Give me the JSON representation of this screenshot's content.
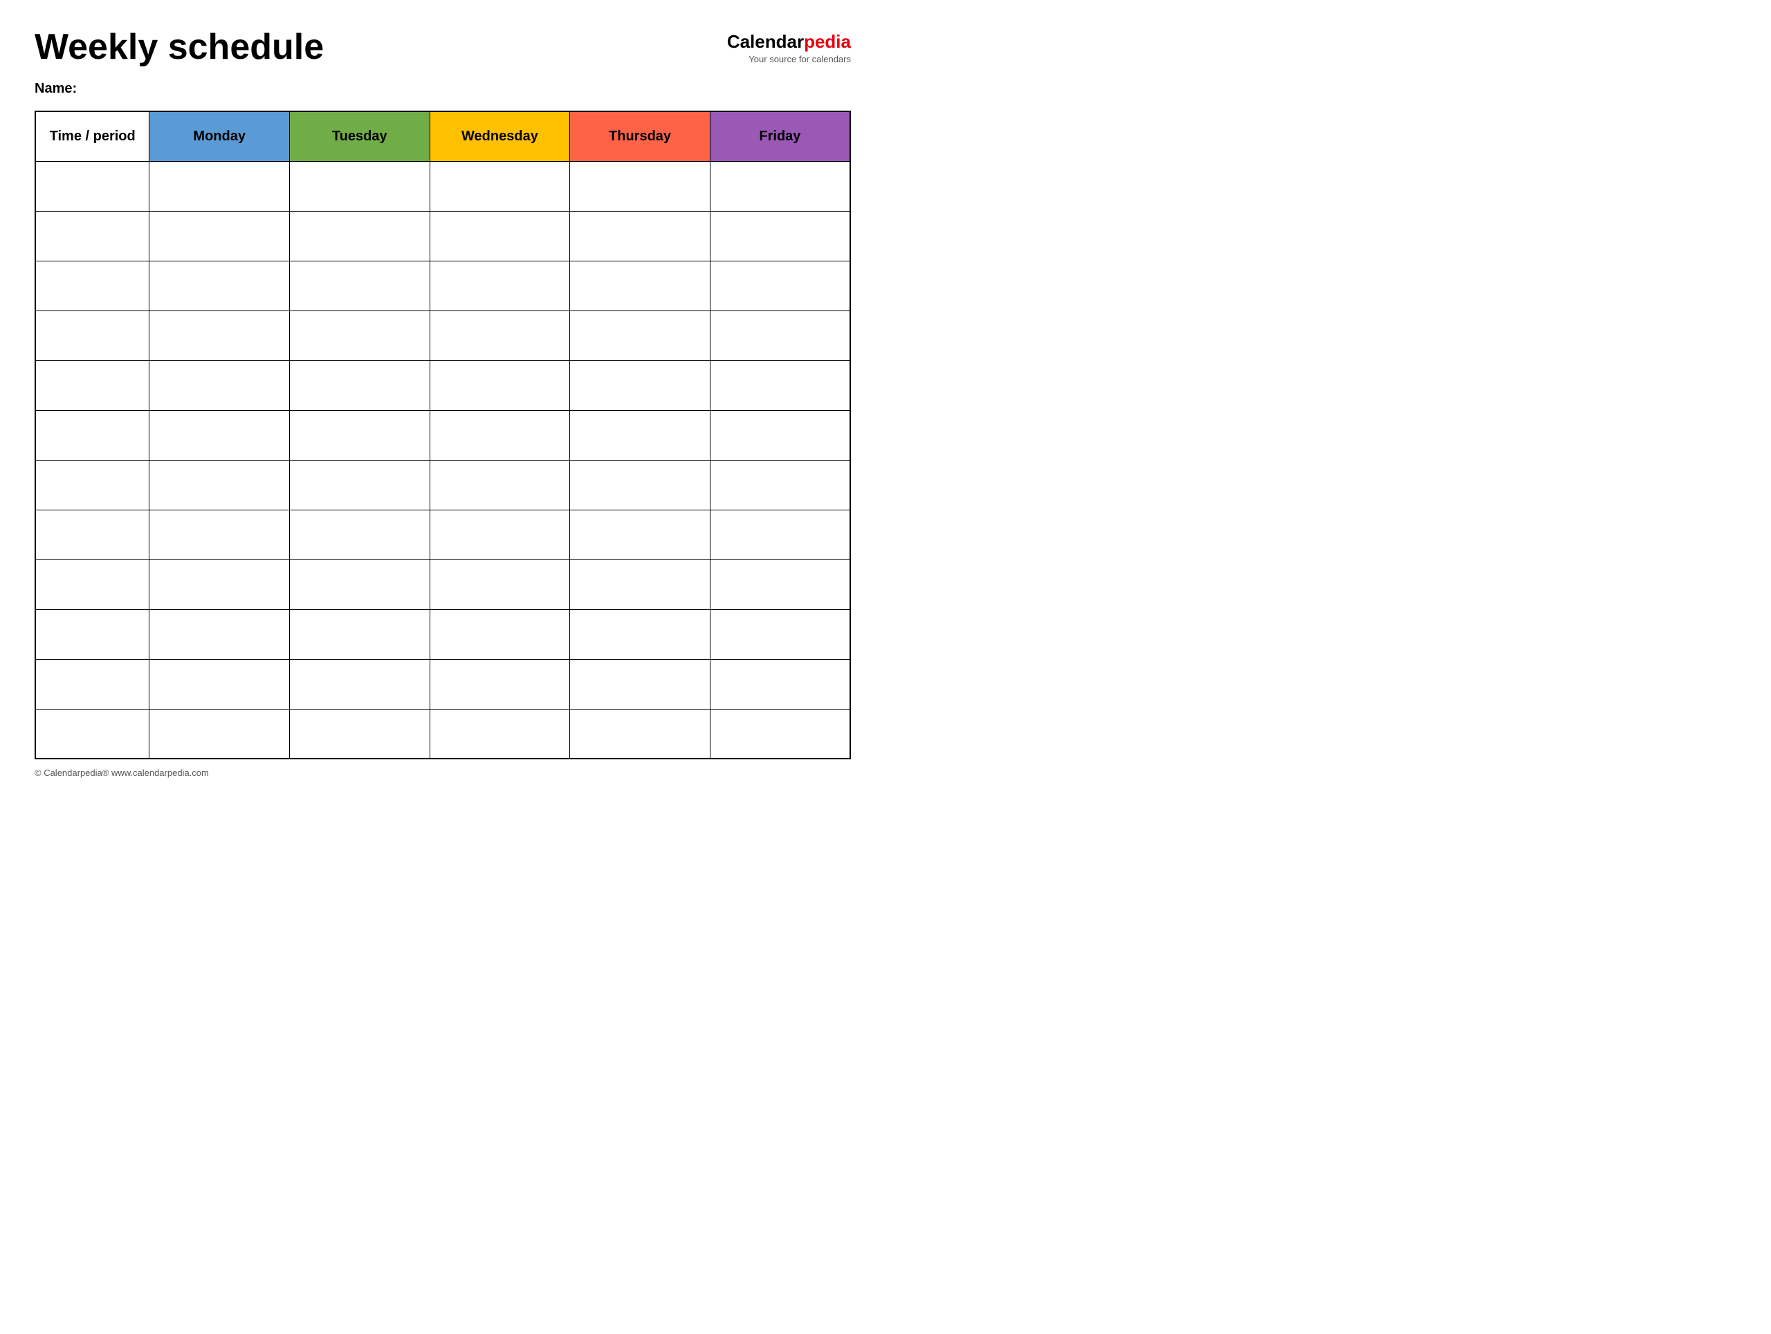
{
  "header": {
    "title": "Weekly schedule",
    "logo": {
      "calendar_text": "Calendar",
      "pedia_text": "pedia",
      "tagline": "Your source for calendars"
    }
  },
  "name_label": "Name:",
  "table": {
    "columns": [
      {
        "key": "time",
        "label": "Time / period",
        "color": "#ffffff"
      },
      {
        "key": "monday",
        "label": "Monday",
        "color": "#5b9bd5"
      },
      {
        "key": "tuesday",
        "label": "Tuesday",
        "color": "#70ad47"
      },
      {
        "key": "wednesday",
        "label": "Wednesday",
        "color": "#ffc000"
      },
      {
        "key": "thursday",
        "label": "Thursday",
        "color": "#ff6347"
      },
      {
        "key": "friday",
        "label": "Friday",
        "color": "#9b59b6"
      }
    ],
    "row_count": 12
  },
  "footer": {
    "text": "© Calendarpedia®  www.calendarpedia.com"
  }
}
